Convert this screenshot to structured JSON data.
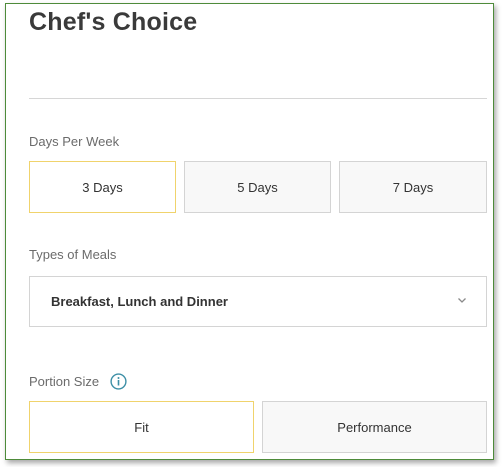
{
  "header": {
    "title": "Chef's Choice"
  },
  "days_per_week": {
    "label": "Days Per Week",
    "options": [
      "3 Days",
      "5 Days",
      "7 Days"
    ],
    "selected": "3 Days"
  },
  "types_of_meals": {
    "label": "Types of Meals",
    "value": "Breakfast, Lunch and Dinner"
  },
  "portion_size": {
    "label": "Portion Size",
    "options": [
      "Fit",
      "Performance"
    ],
    "selected": "Fit"
  },
  "colors": {
    "selected_border": "#f0d36c",
    "info_icon": "#3d8fa6",
    "frame_border": "#4e8b3a"
  },
  "icons": {
    "info": "info-icon",
    "dropdown": "chevron-down-icon"
  }
}
